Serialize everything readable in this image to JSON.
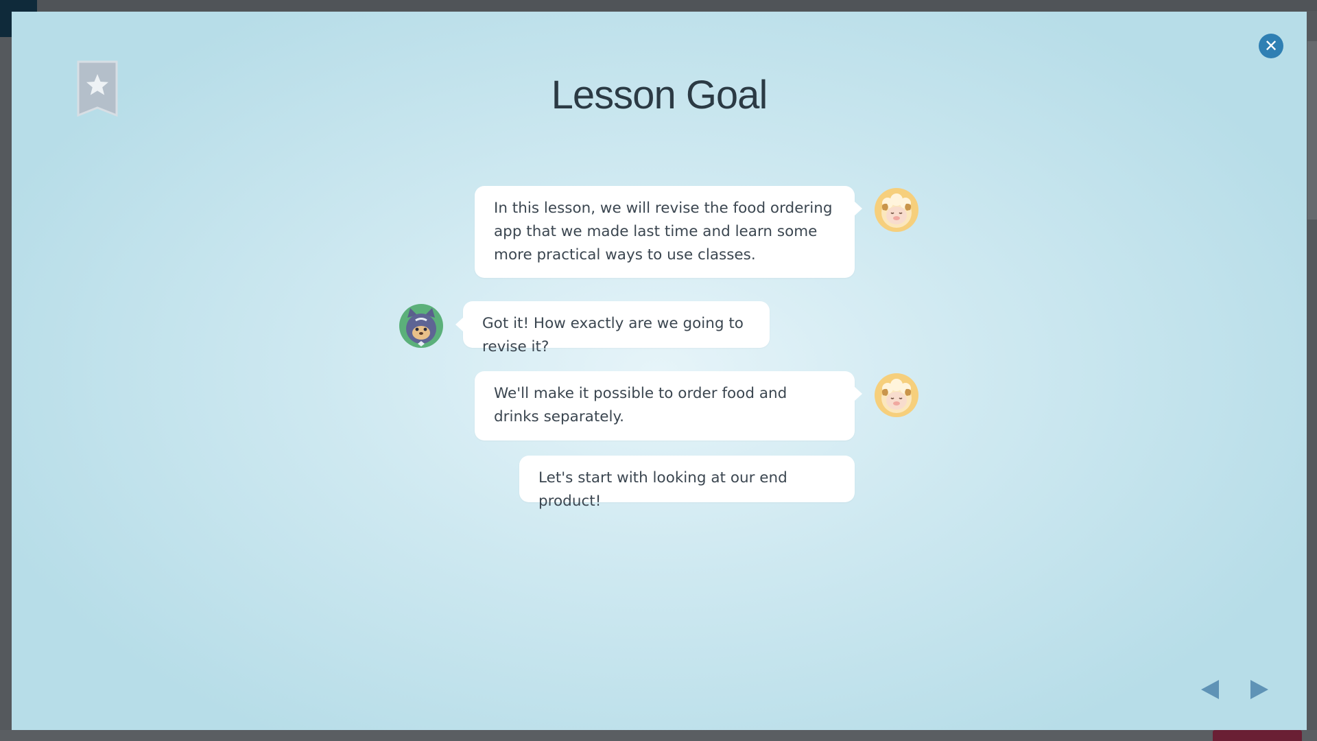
{
  "modal": {
    "title": "Lesson Goal",
    "close_icon": "close-icon",
    "bookmark_icon": "bookmark-star-icon"
  },
  "chat": [
    {
      "speaker": "sheep",
      "side": "right",
      "text": "In this lesson, we will revise the food ordering app that we made last time and learn some more practical ways to use classes."
    },
    {
      "speaker": "cat",
      "side": "left",
      "text": "Got it! How exactly are we going to revise it?"
    },
    {
      "speaker": "sheep",
      "side": "right",
      "text": "We'll make it possible to order food and drinks separately."
    },
    {
      "speaker": "sheep",
      "side": "right",
      "text": "Let's start with looking at our end product!"
    }
  ],
  "navigation": {
    "prev_icon": "triangle-left-icon",
    "next_icon": "triangle-right-icon"
  },
  "colors": {
    "accent": "#2f7fb3",
    "nav_arrow": "#5f93b6",
    "text": "#3b4650",
    "title": "#2b3a44"
  }
}
